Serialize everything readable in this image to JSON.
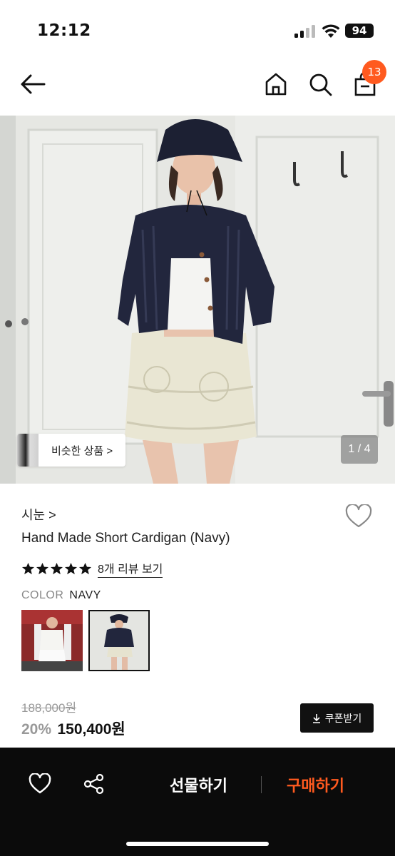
{
  "status_bar": {
    "time": "12:12",
    "battery": "94",
    "icons": [
      "signal-icon",
      "wifi-icon",
      "battery-icon"
    ]
  },
  "nav": {
    "icons": [
      "back-arrow-icon",
      "home-icon",
      "search-icon",
      "shopping-bag-icon"
    ],
    "cart_count": "13",
    "accent_color": "#ff5a1f"
  },
  "hero": {
    "similar_label": "비슷한 상품 >",
    "page_indicator": "1 / 4"
  },
  "product": {
    "brand": "시눈 >",
    "title": "Hand Made Short Cardigan (Navy)",
    "rating_stars": 5,
    "review_link": "8개 리뷰 보기",
    "color_label": "COLOR",
    "color_value": "NAVY",
    "swatches": [
      "white-variant",
      "navy-variant"
    ],
    "selected_swatch": "navy-variant"
  },
  "price": {
    "original": "188,000원",
    "discount": "20%",
    "final": "150,400원",
    "coupon_label": "쿠폰받기"
  },
  "bottom_bar": {
    "gift_label": "선물하기",
    "buy_label": "구매하기",
    "buy_color": "#ff5a1f"
  }
}
